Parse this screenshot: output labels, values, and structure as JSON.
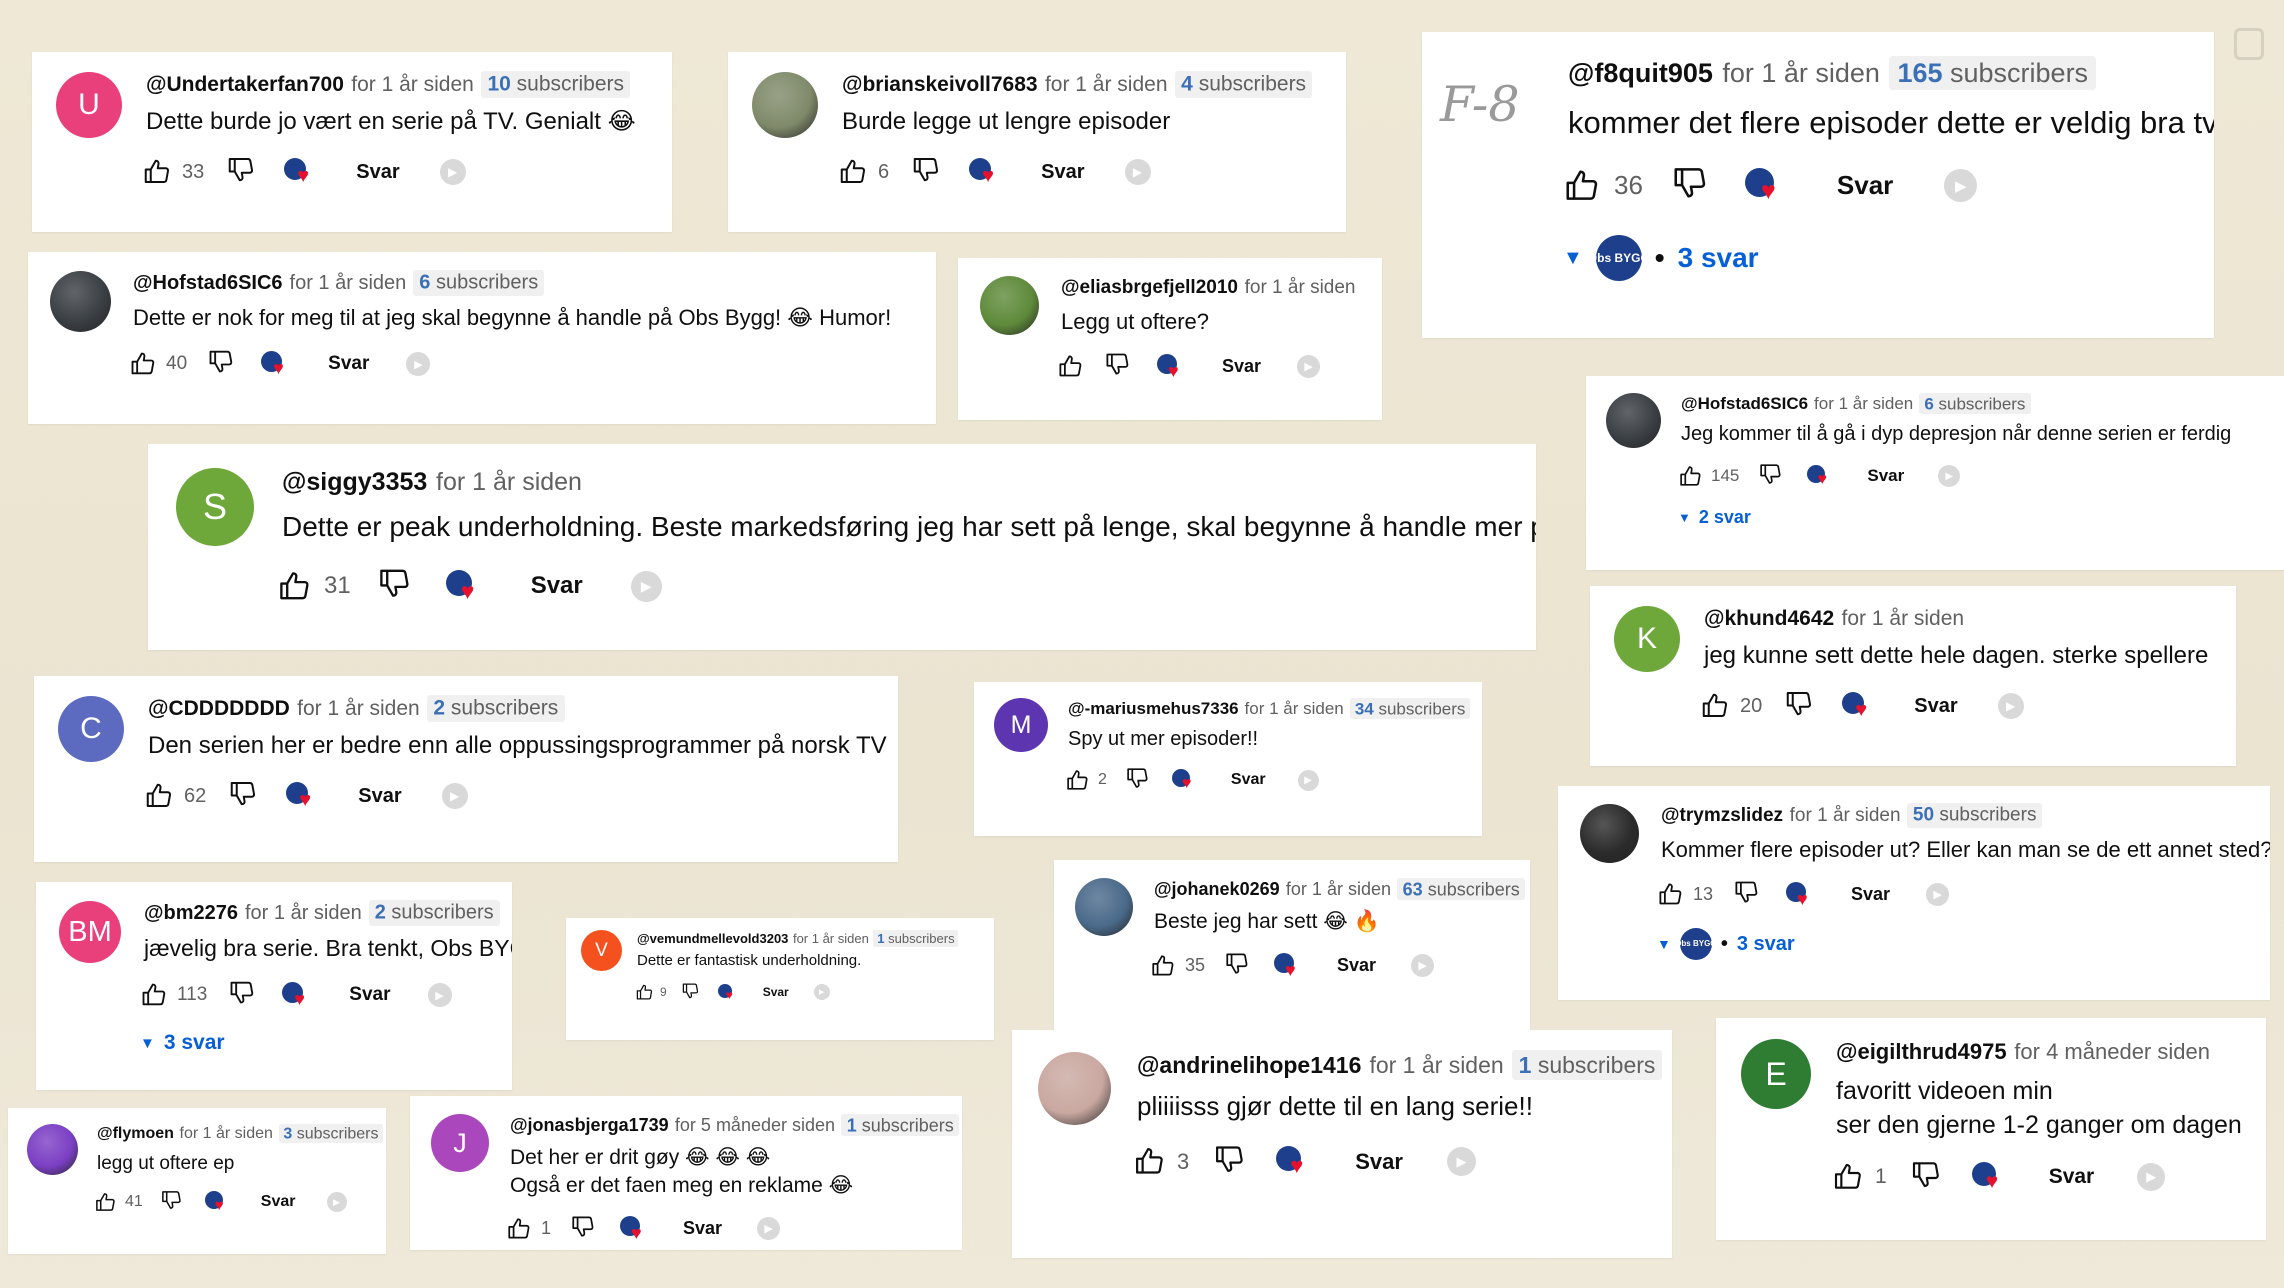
{
  "ui": {
    "reply_label": "Svar"
  },
  "comments": [
    {
      "handle": "@Undertakerfan700",
      "time": "for 1 år siden",
      "subs_num": "10",
      "subs_word": "subscribers",
      "avatar_letter": "U",
      "avatar_color": "#e9407b",
      "text": "Dette burde jo vært en serie på TV. Genialt 😂",
      "likes": "33",
      "replies": ""
    },
    {
      "handle": "@brianskeivoll7683",
      "time": "for 1 år siden",
      "subs_num": "4",
      "subs_word": "subscribers",
      "avatar_letter": "",
      "avatar_color": "#7f8a6a",
      "text": "Burde legge ut lengre episoder",
      "likes": "6",
      "replies": ""
    },
    {
      "handle": "@f8quit905",
      "time": "for 1 år siden",
      "subs_num": "165",
      "subs_word": "subscribers",
      "avatar_letter": "",
      "avatar_color": "#ffffff",
      "text": "kommer det flere episoder dette er veldig bra tv",
      "likes": "36",
      "replies": "3 svar"
    },
    {
      "handle": "@Hofstad6SIC6",
      "time": "for 1 år siden",
      "subs_num": "6",
      "subs_word": "subscribers",
      "avatar_letter": "",
      "avatar_color": "#3a3f44",
      "text": "Dette er nok for meg til at jeg skal begynne å handle på Obs Bygg! 😂 Humor!",
      "likes": "40",
      "replies": ""
    },
    {
      "handle": "@eliasbrgefjell2010",
      "time": "for 1 år siden",
      "subs_num": "",
      "subs_word": "",
      "avatar_letter": "",
      "avatar_color": "#5e8a3a",
      "text": "Legg ut oftere?",
      "likes": "",
      "replies": ""
    },
    {
      "handle": "@Hofstad6SIC6",
      "time": "for 1 år siden",
      "subs_num": "6",
      "subs_word": "subscribers",
      "avatar_letter": "",
      "avatar_color": "#3a3f44",
      "text": "Jeg kommer til å gå i dyp depresjon når denne serien er ferdig",
      "likes": "145",
      "replies": "2 svar"
    },
    {
      "handle": "@siggy3353",
      "time": "for 1 år siden",
      "subs_num": "",
      "subs_word": "",
      "avatar_letter": "S",
      "avatar_color": "#6fa83a",
      "text": "Dette er peak underholdning. Beste markedsføring jeg har sett på lenge, skal begynne å handle mer på OBS",
      "likes": "31",
      "replies": ""
    },
    {
      "handle": "@khund4642",
      "time": "for 1 år siden",
      "subs_num": "",
      "subs_word": "",
      "avatar_letter": "K",
      "avatar_color": "#6fa83a",
      "text": "jeg kunne sett dette hele dagen. sterke spellere",
      "likes": "20",
      "replies": ""
    },
    {
      "handle": "@CDDDDDDD",
      "time": "for 1 år siden",
      "subs_num": "2",
      "subs_word": "subscribers",
      "avatar_letter": "C",
      "avatar_color": "#5c6bc0",
      "text": "Den serien her er bedre enn alle oppussingsprogrammer på norsk TV",
      "likes": "62",
      "replies": ""
    },
    {
      "handle": "@-mariusmehus7336",
      "time": "for 1 år siden",
      "subs_num": "34",
      "subs_word": "subscribers",
      "avatar_letter": "M",
      "avatar_color": "#5e35b1",
      "text": "Spy ut mer episoder!!",
      "likes": "2",
      "replies": ""
    },
    {
      "handle": "@trymzslidez",
      "time": "for 1 år siden",
      "subs_num": "50",
      "subs_word": "subscribers",
      "avatar_letter": "",
      "avatar_color": "#2b2b2b",
      "text": "Kommer flere episoder ut? Eller kan man se de ett annet sted?",
      "likes": "13",
      "replies": "3 svar"
    },
    {
      "handle": "@bm2276",
      "time": "for 1 år siden",
      "subs_num": "2",
      "subs_word": "subscribers",
      "avatar_letter": "BM",
      "avatar_color": "#e9407b",
      "text": "jævelig bra serie. Bra tenkt, Obs BYGG.",
      "likes": "113",
      "replies": "3 svar"
    },
    {
      "handle": "@vemundmellevold3203",
      "time": "for 1 år siden",
      "subs_num": "1",
      "subs_word": "subscribers",
      "avatar_letter": "V",
      "avatar_color": "#f4511e",
      "text": "Dette er fantastisk underholdning.",
      "likes": "9",
      "replies": ""
    },
    {
      "handle": "@johanek0269",
      "time": "for 1 år siden",
      "subs_num": "63",
      "subs_word": "subscribers",
      "avatar_letter": "",
      "avatar_color": "#4a6a8a",
      "text": "Beste jeg har sett 😂 🔥",
      "likes": "35",
      "replies": ""
    },
    {
      "handle": "@andrinelihope1416",
      "time": "for 1 år siden",
      "subs_num": "1",
      "subs_word": "subscribers",
      "avatar_letter": "",
      "avatar_color": "#c9a8a0",
      "text": "pliiiisss gjør dette til en lang serie!!",
      "likes": "3",
      "replies": ""
    },
    {
      "handle": "@eigilthrud4975",
      "time": "for 4 måneder siden",
      "subs_num": "",
      "subs_word": "",
      "avatar_letter": "E",
      "avatar_color": "#2e7d32",
      "text": "favoritt videoen min",
      "text2": "ser den gjerne 1-2 ganger om dagen",
      "likes": "1",
      "replies": ""
    },
    {
      "handle": "@flymoen",
      "time": "for 1 år siden",
      "subs_num": "3",
      "subs_word": "subscribers",
      "avatar_letter": "",
      "avatar_color": "#7b3fc4",
      "text": "legg ut oftere ep",
      "likes": "41",
      "replies": ""
    },
    {
      "handle": "@jonasbjerga1739",
      "time": "for 5 måneder siden",
      "subs_num": "1",
      "subs_word": "subscribers",
      "avatar_letter": "J",
      "avatar_color": "#ab47bc",
      "text": "Det her er drit gøy 😂 😂 😂",
      "text2": "Også er det faen meg en reklame 😂",
      "likes": "1",
      "replies": ""
    }
  ],
  "misc": {
    "handwritten_mark": "F-8",
    "obs_logo_text": "Obs BYGG"
  }
}
